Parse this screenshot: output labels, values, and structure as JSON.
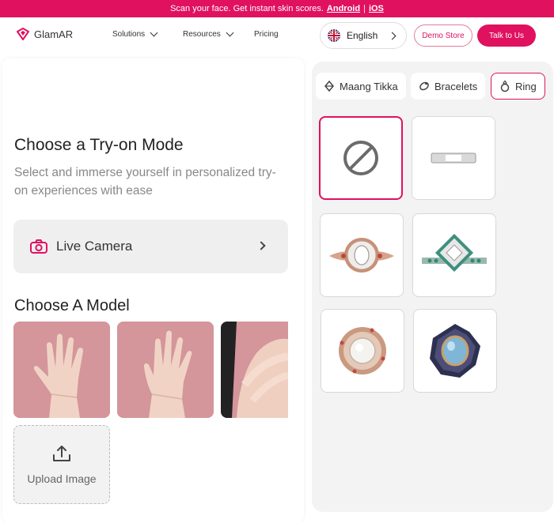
{
  "banner": {
    "text": "Scan your face. Get instant skin scores.",
    "android": "Android",
    "separator": "|",
    "ios": "iOS"
  },
  "nav": {
    "logo": "GlamAR",
    "items": [
      {
        "label": "Solutions"
      },
      {
        "label": "Resources"
      },
      {
        "label": "Pricing"
      }
    ],
    "language": "English",
    "demo_button": "Demo Store",
    "talk_button": "Talk to Us"
  },
  "main": {
    "title": "Choose a Try-on Mode",
    "subtitle": "Select and immerse yourself in personalized try-on experiences with ease",
    "live_camera": "Live Camera",
    "model_title": "Choose A Model",
    "upload_label": "Upload Image"
  },
  "categories": {
    "tabs": [
      {
        "label": "Maang Tikka",
        "icon": "maang-tikka-icon"
      },
      {
        "label": "Bracelets",
        "icon": "bracelet-icon"
      },
      {
        "label": "Ring",
        "icon": "ring-icon",
        "active": true
      }
    ],
    "items": [
      {
        "name": "none",
        "selected": true
      },
      {
        "name": "silver-band"
      },
      {
        "name": "diamond-cluster-ring"
      },
      {
        "name": "emerald-halo-ring"
      },
      {
        "name": "pearl-flower-ring"
      },
      {
        "name": "blue-topaz-ring"
      }
    ]
  },
  "colors": {
    "accent": "#e0115f",
    "panel": "#f3f3f3",
    "muted": "#888888"
  }
}
